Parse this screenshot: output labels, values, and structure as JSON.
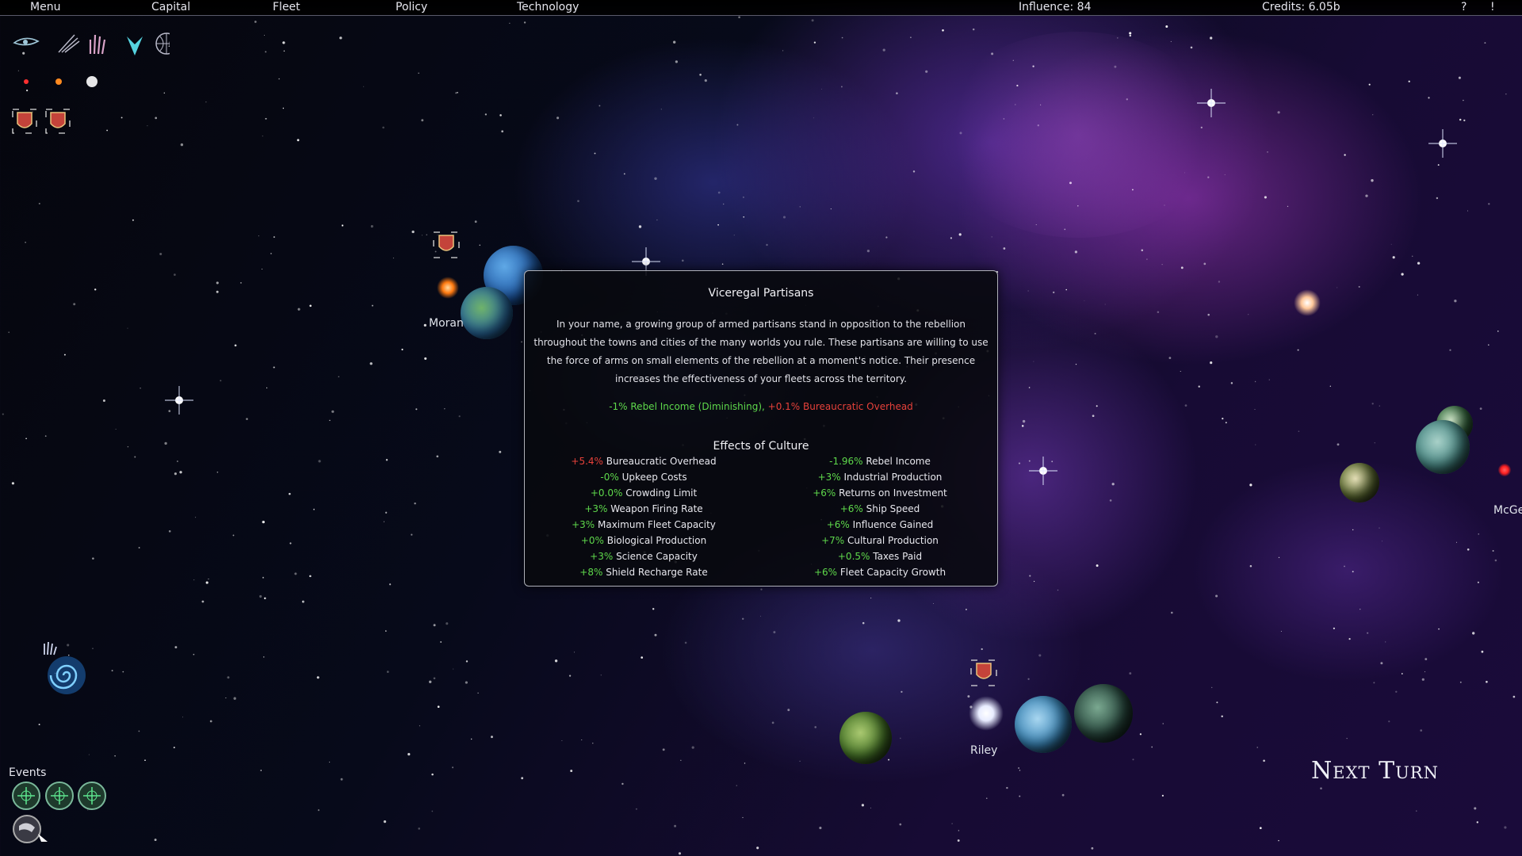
{
  "topbar": {
    "menu": "Menu",
    "capital": "Capital",
    "fleet": "Fleet",
    "policy": "Policy",
    "technology": "Technology",
    "influence": "Influence: 84",
    "credits": "Credits: 6.05b",
    "help": "?",
    "alert": "!"
  },
  "map": {
    "planet_labels": {
      "moran": "Moran",
      "riley": "Riley",
      "mcge": "McGe"
    }
  },
  "popup": {
    "title": "Viceregal Partisans",
    "description": "In your name, a growing group of armed partisans stand in opposition to the rebellion throughout the towns and cities of the many worlds you rule. These partisans are willing to use the force of arms on small elements of the rebellion at a moment's notice. Their presence increases the effectiveness of your fleets across the territory.",
    "effect_positive": "-1% Rebel Income (Diminishing),",
    "effect_negative": " +0.1% Bureaucratic Overhead",
    "culture_title": "Effects of Culture",
    "culture_left": [
      {
        "value": "+5.4%",
        "label": " Bureaucratic Overhead",
        "color": "red"
      },
      {
        "value": "-0%",
        "label": " Upkeep Costs",
        "color": "green"
      },
      {
        "value": "+0.0%",
        "label": " Crowding Limit",
        "color": "green"
      },
      {
        "value": "+3%",
        "label": " Weapon Firing Rate",
        "color": "green"
      },
      {
        "value": "+3%",
        "label": " Maximum Fleet Capacity",
        "color": "green"
      },
      {
        "value": "+0%",
        "label": " Biological Production",
        "color": "green"
      },
      {
        "value": "+3%",
        "label": " Science Capacity",
        "color": "green"
      },
      {
        "value": "+8%",
        "label": " Shield Recharge Rate",
        "color": "green"
      }
    ],
    "culture_right": [
      {
        "value": "-1.96%",
        "label": " Rebel Income",
        "color": "green"
      },
      {
        "value": "+3%",
        "label": " Industrial Production",
        "color": "green"
      },
      {
        "value": "+6%",
        "label": " Returns on Investment",
        "color": "green"
      },
      {
        "value": "+6%",
        "label": " Ship Speed",
        "color": "green"
      },
      {
        "value": "+6%",
        "label": " Influence Gained",
        "color": "green"
      },
      {
        "value": "+7%",
        "label": " Cultural Production",
        "color": "green"
      },
      {
        "value": "+0.5%",
        "label": " Taxes Paid",
        "color": "green"
      },
      {
        "value": "+6%",
        "label": " Fleet Capacity Growth",
        "color": "green"
      }
    ]
  },
  "events": {
    "label": "Events"
  },
  "next_turn": "Next Turn",
  "colors": {
    "positive": "#5ed84b",
    "negative": "#e6413a"
  }
}
